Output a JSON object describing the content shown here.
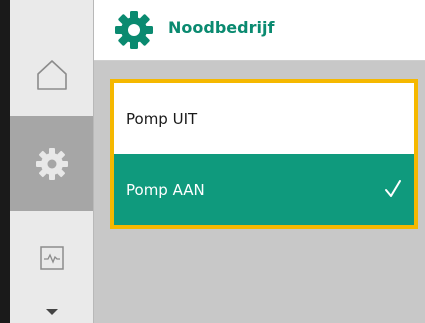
{
  "header": {
    "title": "Noodbedrijf",
    "icon": "gear-icon",
    "accent_color": "#0a8a70"
  },
  "nav": {
    "items": [
      {
        "name": "home",
        "icon": "home-icon"
      },
      {
        "name": "settings",
        "icon": "gear-icon",
        "selected": true
      },
      {
        "name": "diagnostics",
        "icon": "pulse-monitor-icon"
      }
    ],
    "scroll_indicator": "chevron-down-icon"
  },
  "options": {
    "highlight_color": "#f5b800",
    "selected_color": "#0f9a7d",
    "items": [
      {
        "label": "Pomp UIT",
        "selected": false
      },
      {
        "label": "Pomp AAN",
        "selected": true
      }
    ]
  }
}
